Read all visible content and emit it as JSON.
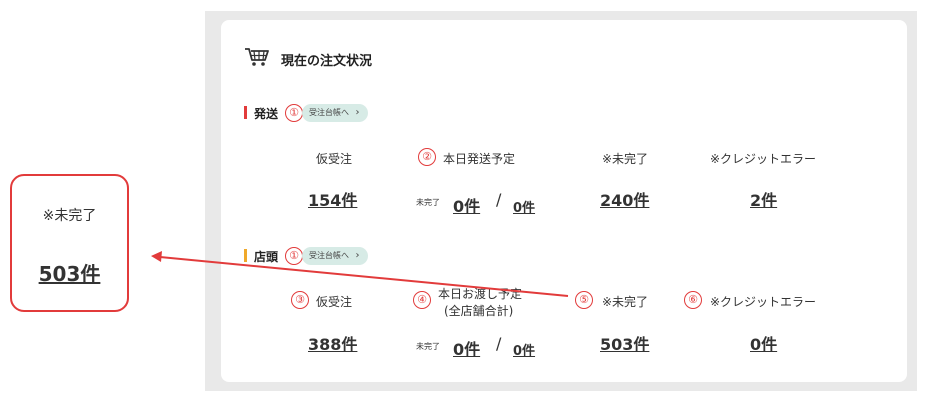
{
  "title": "現在の注文状況",
  "colors": {
    "accent_red": "#e23b3b",
    "shipping_bar": "#e23b3b",
    "store_bar": "#f0a92a",
    "pill_bg": "#d7ebe6"
  },
  "icons": {
    "cart": "shopping-cart-icon",
    "chevron": "chevron-right-icon"
  },
  "shipping": {
    "label": "発送",
    "marker": "①",
    "pill": "受注台帳へ",
    "items": [
      {
        "label": "仮受注",
        "value": "154件"
      },
      {
        "marker": "②",
        "label": "本日発送予定",
        "prefix": "未完了",
        "value": "0件",
        "separator": "/",
        "value2": "0件"
      },
      {
        "label": "※未完了",
        "value": "240件"
      },
      {
        "label": "※クレジットエラー",
        "value": "2件"
      }
    ]
  },
  "store": {
    "label": "店頭",
    "marker": "①",
    "pill": "受注台帳へ",
    "items": [
      {
        "marker": "③",
        "label": "仮受注",
        "value": "388件"
      },
      {
        "marker": "④",
        "label_line1": "本日お渡し予定",
        "label_line2": "(全店舗合計)",
        "prefix": "未完了",
        "value": "0件",
        "separator": "/",
        "value2": "0件"
      },
      {
        "marker": "⑤",
        "label": "※未完了",
        "value": "503件"
      },
      {
        "marker": "⑥",
        "label": "※クレジットエラー",
        "value": "0件"
      }
    ]
  },
  "callout": {
    "label": "※未完了",
    "value": "503件"
  }
}
